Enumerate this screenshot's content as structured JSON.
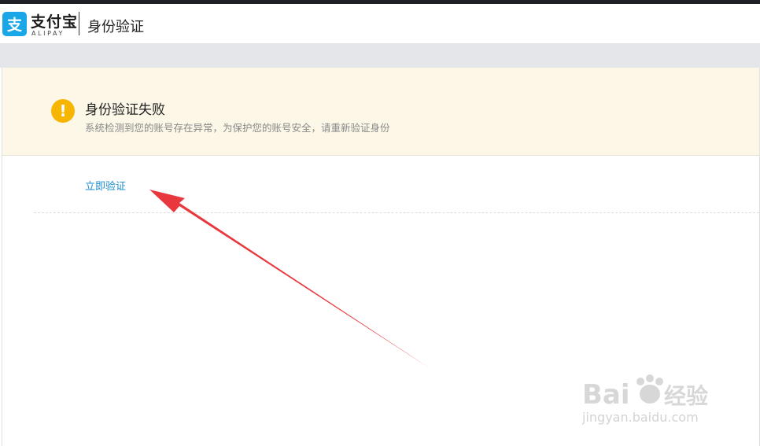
{
  "header": {
    "logo_cn": "支付宝",
    "logo_en": "ALIPAY",
    "logo_badge_glyph": "支",
    "title": "身份验证"
  },
  "alert": {
    "icon": "warning-icon",
    "icon_glyph": "!",
    "title": "身份验证失败",
    "description": "系统检测到您的账号存在异常，为保护您的账号安全，请重新验证身份"
  },
  "action": {
    "verify_link": "立即验证"
  },
  "watermark": {
    "brand": "Bai",
    "brand_tail": "经验",
    "url": "jingyan.baidu.com"
  },
  "colors": {
    "brand_blue": "#1aa7e8",
    "link_blue": "#1a8ccc",
    "warning_yellow": "#f6b500",
    "alert_bg": "#fdf7e8",
    "annotation_arrow": "#e8383d"
  }
}
